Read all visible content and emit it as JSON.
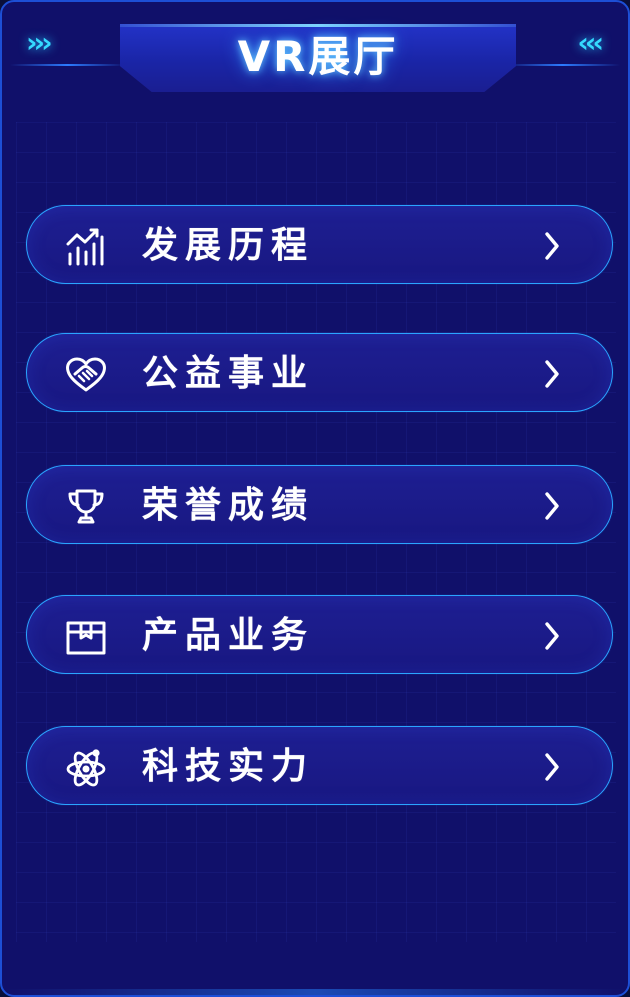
{
  "header": {
    "title": "VR展厅",
    "decor_left": "›››",
    "decor_right": "‹‹‹"
  },
  "menu": {
    "items": [
      {
        "label": "发展历程",
        "icon": "growth-chart-icon",
        "arrow": "chevron-right-icon"
      },
      {
        "label": "公益事业",
        "icon": "heart-handshake-icon",
        "arrow": "chevron-right-icon"
      },
      {
        "label": "荣誉成绩",
        "icon": "trophy-icon",
        "arrow": "chevron-right-icon"
      },
      {
        "label": "产品业务",
        "icon": "box-icon",
        "arrow": "chevron-right-icon"
      },
      {
        "label": "科技实力",
        "icon": "atom-icon",
        "arrow": "chevron-right-icon"
      }
    ]
  },
  "colors": {
    "background": "#10106a",
    "panel_border": "#2aa4ff",
    "title_glow": "#66c8ff",
    "accent": "#35d9ff",
    "text": "#ffffff"
  }
}
